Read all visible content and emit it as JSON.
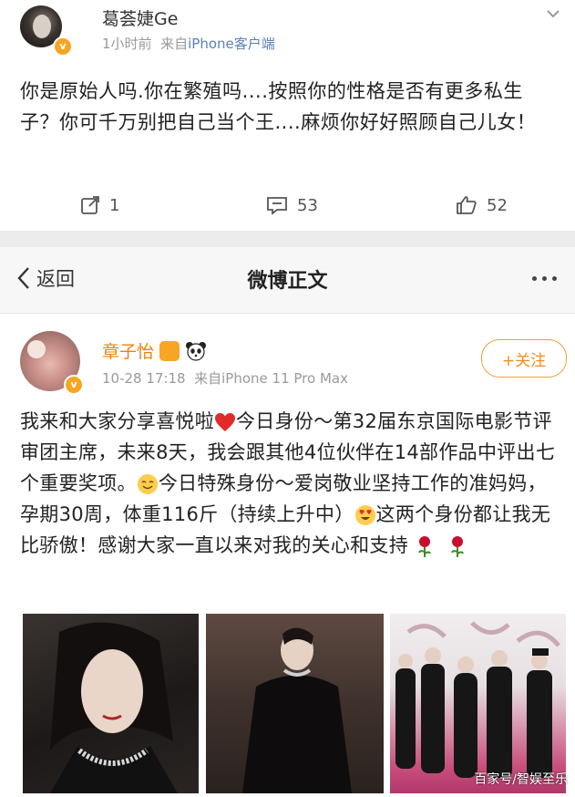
{
  "post1": {
    "author": "葛荟婕Ge",
    "time": "1小时前",
    "source_prefix": "来自",
    "source": "iPhone客户端",
    "text": "你是原始人吗.你在繁殖吗....按照你的性格是否有更多私生子？你可千万别把自己当个王....麻烦你好好照顾自己儿女！",
    "repost_count": "1",
    "comment_count": "53",
    "like_count": "52"
  },
  "nav": {
    "back_label": "返回",
    "title": "微博正文"
  },
  "post2": {
    "author": "章子怡",
    "time": "10-28 17:18",
    "source": "来自iPhone 11 Pro Max",
    "follow_label": "+关注",
    "text_part1": "我来和大家分享喜悦啦",
    "text_part2": "今日身份～第32届东京国际电影节评审团主席，未来8天，我会跟其他4位伙伴在14部作品中评出七个重要奖项。",
    "text_part3": "今日特殊身份～爱岗敬业坚持工作的准妈妈，孕期30周，体重116斤（持续上升中）",
    "text_part4": "这两个身份都让我无比骄傲！感谢大家一直以来对我的关心和支持"
  },
  "watermark": "百家号/智娱至乐",
  "colors": {
    "orange": "#f08c1e",
    "link": "#5b80b8",
    "vip": "#f6a623"
  },
  "icons": [
    "chevron-down-icon",
    "repost-icon",
    "comment-icon",
    "like-icon",
    "back-icon",
    "more-icon",
    "heart-emoji",
    "smile-emoji",
    "love-eyes-emoji",
    "rose-emoji"
  ]
}
